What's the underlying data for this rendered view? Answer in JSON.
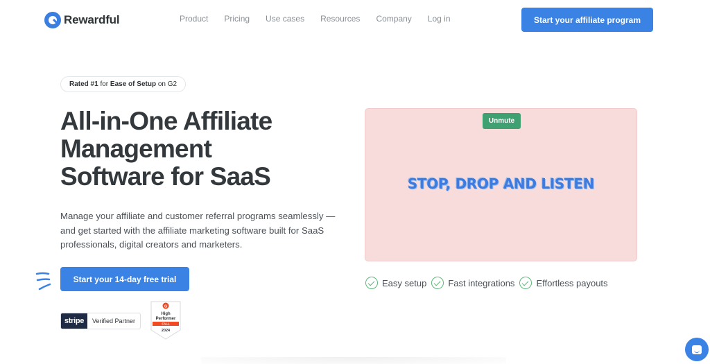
{
  "brand": {
    "name": "Rewardful"
  },
  "nav": {
    "links": [
      "Product",
      "Pricing",
      "Use cases",
      "Resources",
      "Company",
      "Log in"
    ],
    "cta": "Start your affiliate program"
  },
  "hero": {
    "badge": {
      "pre": "Rated #1",
      "mid": " for ",
      "bold": "Ease of Setup",
      "post": " on G2"
    },
    "title_lines": [
      "All-in-One Affiliate",
      "Management",
      "Software for SaaS"
    ],
    "subtitle": "Manage your affiliate and customer referral programs seamlessly — and get started with the affiliate marketing software built for SaaS professionals, digital creators and marketers.",
    "cta": "Start your 14-day free trial",
    "stripe": {
      "logo": "stripe",
      "label": "Verified Partner"
    },
    "g2": {
      "line1": "High",
      "line2": "Performer",
      "season": "FALL",
      "year": "2024"
    }
  },
  "video": {
    "unmute_label": "Unmute",
    "overlay_text": "STOP, DROP AND LISTEN"
  },
  "features": [
    "Easy setup",
    "Fast integrations",
    "Effortless payouts"
  ],
  "colors": {
    "primary": "#3a82e4",
    "video_bg": "#f8dcdc",
    "unmute": "#3fa171",
    "check": "#5cb87a",
    "heading": "#33383c"
  }
}
